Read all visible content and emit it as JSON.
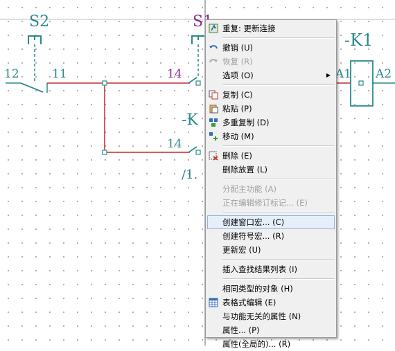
{
  "schematic": {
    "s2_label": "S2",
    "s1_label": "S1",
    "k1_top_label": "-K1",
    "k1_left_label": "-K",
    "pin_12": "12",
    "pin_11": "11",
    "pin_14_top": "14",
    "pin_14_bottom": "14",
    "pin_a1": "A1",
    "pin_a2": "A2",
    "ref_fraction": "/1.",
    "colors": {
      "wire": "#c62828",
      "symbol": "#2a8a8a",
      "label_purple": "#8a2a8a"
    }
  },
  "menu": {
    "items": [
      {
        "label": "重复: 更新连接",
        "icon": "repeat-icon",
        "disabled": false
      },
      {
        "label": "撤销 (U)",
        "icon": "undo-icon",
        "disabled": false
      },
      {
        "label": "恢复 (R)",
        "icon": "redo-icon",
        "disabled": true
      },
      {
        "label": "选项 (O)",
        "icon": "",
        "disabled": false,
        "submenu": true
      },
      {
        "label": "复制 (C)",
        "icon": "copy-icon",
        "disabled": false
      },
      {
        "label": "粘贴 (P)",
        "icon": "paste-icon",
        "disabled": false
      },
      {
        "label": "多重复制 (D)",
        "icon": "multi-copy-icon",
        "disabled": false
      },
      {
        "label": "移动 (M)",
        "icon": "move-icon",
        "disabled": false
      },
      {
        "label": "删除 (E)",
        "icon": "delete-icon",
        "disabled": false
      },
      {
        "label": "删除放置 (L)",
        "icon": "",
        "disabled": false
      },
      {
        "label": "分配主功能 (A)",
        "icon": "",
        "disabled": true
      },
      {
        "label": "正在编辑修订标记... (E)",
        "icon": "",
        "disabled": true
      },
      {
        "label": "创建窗口宏... (C)",
        "icon": "",
        "disabled": false,
        "highlighted": true
      },
      {
        "label": "创建符号宏... (R)",
        "icon": "",
        "disabled": false
      },
      {
        "label": "更新宏 (U)",
        "icon": "",
        "disabled": false
      },
      {
        "label": "插入查找结果列表 (I)",
        "icon": "",
        "disabled": false
      },
      {
        "label": "相同类型的对象 (H)",
        "icon": "",
        "disabled": false
      },
      {
        "label": "表格式编辑 (E)",
        "icon": "table-icon",
        "disabled": false
      },
      {
        "label": "与功能无关的属性 (N)",
        "icon": "",
        "disabled": false
      },
      {
        "label": "属性... (P)",
        "icon": "",
        "disabled": false
      },
      {
        "label": "属性(全局的)... (R)",
        "icon": "",
        "disabled": false
      }
    ]
  }
}
